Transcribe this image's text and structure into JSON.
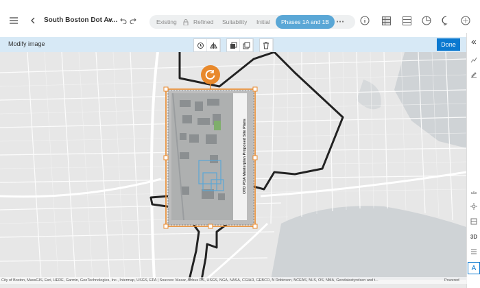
{
  "app": {
    "project_title": "South Boston Dot Av...",
    "icons": [
      "hamburger-icon",
      "back-chevron-icon",
      "dropdown-chevron-icon",
      "undo-icon",
      "redo-icon",
      "more-icon",
      "info-icon",
      "table-icon",
      "layers-icon",
      "chart-icon",
      "comment-icon",
      "share-icon"
    ]
  },
  "scenario_tabs": [
    {
      "label": "Existing",
      "active": false
    },
    {
      "label": "Refined",
      "active": false
    },
    {
      "label": "Suitability",
      "active": false
    },
    {
      "label": "Initial",
      "active": false
    },
    {
      "label": "Phases 1A and 1B",
      "active": true
    }
  ],
  "modify_bar": {
    "label": "Modify image",
    "done_label": "Done",
    "tools": [
      "rotate-icon",
      "flip-icon",
      "send-back-icon",
      "bring-front-icon",
      "delete-icon"
    ]
  },
  "map": {
    "overlay_caption": "OTD PDA Masterplan Proposed Site Plans",
    "attribution": "City of Boston, MassGIS, Esri, HERE, Garmin, GeoTechnologies, Inc., Intermap, USGS, EPA | Sources: Maxar, Airbus DS, USGS, NGA, NASA, CGIAR, GEBCO, N Robinson, NCEAS, NLS, OS, NMA, Geodatastyrelsen and t...",
    "powered_by": "Powered",
    "colors": {
      "boundary": "#222222",
      "handle": "#e8892c",
      "water": "#cfd3d6"
    }
  },
  "right_panel": {
    "collapse_icon": "double-chevron-left-icon",
    "view_3d_label": "3D",
    "text_label": "A"
  }
}
